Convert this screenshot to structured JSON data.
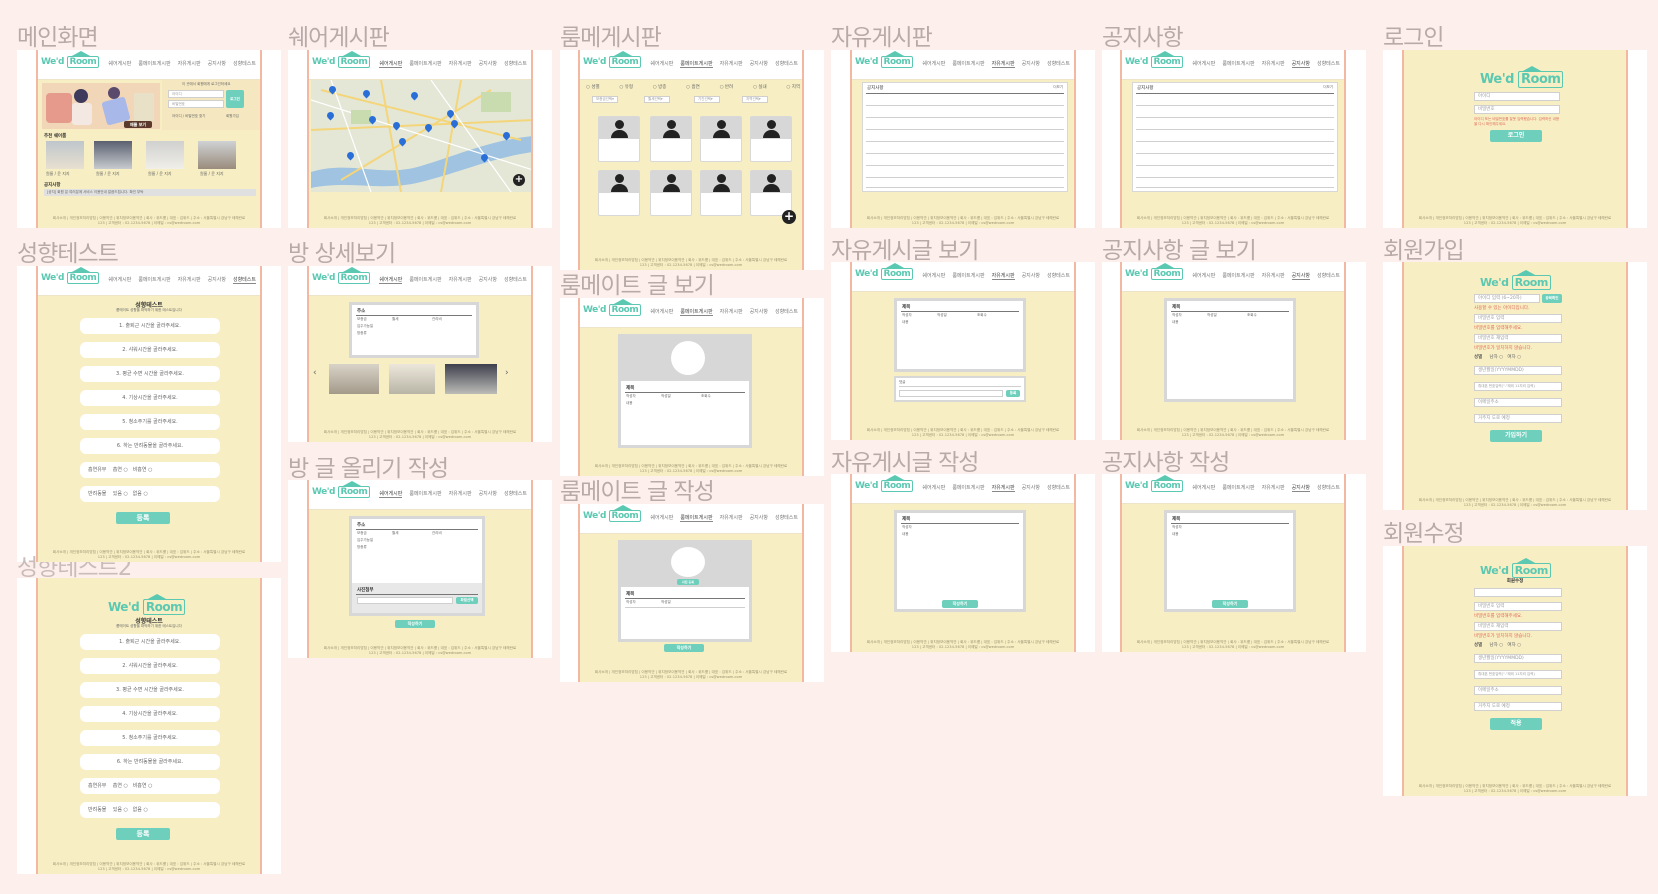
{
  "brand": {
    "logo_text_a": "We'd ",
    "logo_text_b": "Room",
    "accent": "#6ecfbc",
    "page_bg": "#fdf0ec",
    "screen_bg": "#f7eec3",
    "border": "#f2b8a2"
  },
  "nav_menu": [
    "쉐어게시판",
    "룸메이트게시판",
    "자유게시판",
    "공지사항",
    "성향테스트"
  ],
  "frames": {
    "main": "메인화면",
    "share": "쉐어게시판",
    "room": "룸메게시판",
    "free": "자유게시판",
    "notice": "공지사항",
    "login": "로그인",
    "test": "성향테스트",
    "room_detail": "방 상세보기",
    "freeview": "자유게시글 보기",
    "noticeview": "공지사항 글 보기",
    "signup": "회원가입",
    "roommate_view": "룸메이트 글 보기",
    "room_write": "방 글 올리기 작성",
    "roommate_write": "룸메이트 글 작성",
    "free_write": "자유게시글 작성",
    "notice_write": "공지사항 작성",
    "edit": "회원수정",
    "test2": "성향테스트2"
  },
  "main_screen": {
    "banner_button": "매물 보기",
    "login_note": "이 곳에서 회원에게 로그인하세요",
    "id_placeholder": "아이디",
    "pw_placeholder": "비밀번호",
    "login_button": "로그인",
    "link_find": "아이디 / 비밀번호 찾기",
    "link_join": "회원가입",
    "recommend_title": "추천 쉐어룸",
    "rooms": [
      "원룸 / 윤 지지",
      "원룸 / 윤 지지",
      "원룸 / 윤 지지",
      "원룸 / 윤 지지"
    ],
    "notice_title": "공지사항",
    "notice_text": "[공지] 회원 분 여러분께 서비스 이용안내 말씀드립니다. 확인 부탁"
  },
  "notice_board_title": "공지사항",
  "notice_board_more": "더보기",
  "room_filters": [
    "성별",
    "유형",
    "방종",
    "흡연",
    "반려",
    "실내",
    "지역"
  ],
  "room_dropdowns": [
    "보증금선택",
    "월세선택",
    "기간선택",
    "지역선택"
  ],
  "login_screen": {
    "id_placeholder": "아이디",
    "pw_placeholder": "비밀번호",
    "error": "아이디 또는 비밀번호를 잘못 입력했습니다. 입력하신 내용을 다시 확인해주세요.",
    "button": "로그인"
  },
  "test_screen": {
    "title": "성향테스트",
    "subtitle": "룸메이트 성향을 파악하기 위한 테스트입니다",
    "questions": [
      "1. 출퇴근 시간을 골라주세요.",
      "2. 샤워시간을 골라주세요.",
      "3. 평균 수면 시간을 골라주세요.",
      "4. 기상시간을 골라주세요.",
      "5. 청소주기를 골라주세요.",
      "6. 하는 반려동물을 골라주세요."
    ],
    "smoke_label": "흡연유무",
    "smoke_options": [
      "흡연",
      "비흡연"
    ],
    "pet_label": "반려동물",
    "pet_options": [
      "있음",
      "없음"
    ],
    "submit": "등록"
  },
  "room_detail_screen": {
    "addr_label": "주소",
    "fields": [
      "보증금",
      "월세",
      "관리비",
      "입주가능일",
      "방종류"
    ]
  },
  "view_screen": {
    "title_label": "제목",
    "meta": [
      "작성자",
      "작성일",
      "조회수"
    ],
    "body_label": "내용"
  },
  "comment_placeholder": "댓글",
  "comment_button": "등록",
  "write_screen": {
    "addr_label": "주소",
    "title_label": "제목",
    "photo_label": "사진첨부",
    "attach_button": "파일선택",
    "submit": "작성하기",
    "photo_button": "사진 등록"
  },
  "signup_screen": {
    "id_placeholder": "아이디 입력 (6~20자)",
    "check_button": "중복확인",
    "id_err": "사용할 수 있는 아이디입니다.",
    "pw_placeholder": "비밀번호 입력",
    "pw_err": "비밀번호를 입력해주세요.",
    "pw2_placeholder": "비밀번호 재입력",
    "pw2_err": "비밀번호가 일치하지 않습니다.",
    "gender_label": "성별",
    "gender_opts": [
      "남자",
      "여자"
    ],
    "birth_placeholder": "생년월일(YYYYMMDD)",
    "phone_placeholder": "휴대폰 번호입력(\"-\"제외 11자리 입력)",
    "email_placeholder": "이메일주소",
    "addr_placeholder": "거주지 도로 예정",
    "submit": "가입하기"
  },
  "edit_screen": {
    "heading": "회원수정",
    "submit": "적용"
  },
  "footer_text": "회사소개 | 개인정보처리방침 | 이용약관 | 위치정보이용약관 | 회사 : 위드룸 | 대표 : 김위드 | 주소 : 서울특별시 강남구 테헤란로 123 | 고객센터 : 02-1234-5678 | 이메일 : cs@wedroom.com"
}
